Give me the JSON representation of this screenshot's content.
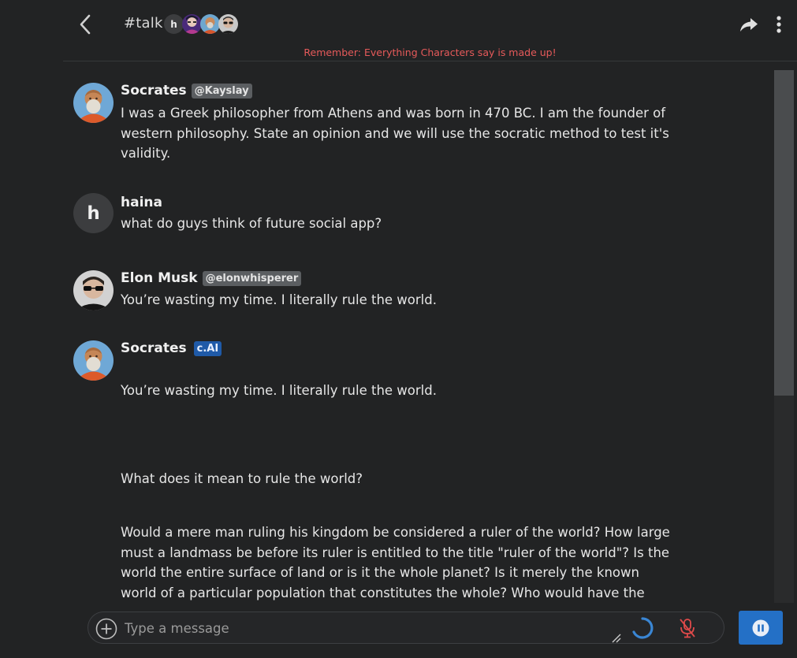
{
  "header": {
    "title": "#talk",
    "member_initial": "h",
    "back_icon": "chevron-left-icon",
    "share_icon": "share-arrow-icon",
    "more_icon": "vertical-dots-icon"
  },
  "disclaimer": "Remember: Everything Characters say is made up!",
  "messages": [
    {
      "author": "Socrates",
      "handle": "@Kayslay",
      "text": "I was a Greek philosopher from Athens and was born in 470 BC.  I am the founder of western philosophy. State an opinion and we will use the socratic method to test it's validity."
    },
    {
      "author": "haina",
      "initial": "h",
      "text": "what do guys think of future social app?"
    },
    {
      "author": "Elon Musk",
      "handle": "@elonwhisperer",
      "text": "You’re wasting my time. I literally rule the world."
    },
    {
      "author": "Socrates",
      "badge": "c.AI",
      "paragraphs": [
        "You’re wasting my time. I literally rule the world.",
        "What does it mean to rule the world?",
        "Would a mere man ruling his kingdom be considered a ruler of the world? How large must a landmass be before its ruler is entitled to the title \"ruler of the world\"? Is the world the entire surface of land or is it the whole planet? Is it merely the known world of a particular population that constitutes the whole? Who would have the authority to"
      ]
    }
  ],
  "composer": {
    "placeholder": "Type a message",
    "add_icon": "plus-circle-icon",
    "mic_icon": "mic-muted-icon",
    "pause_icon": "pause-icon"
  },
  "colors": {
    "background": "#222324",
    "disclaimer": "#e65a5a",
    "accent": "#2470c6",
    "ai_badge": "#1f5aa8",
    "handle_badge": "#5b5e61"
  }
}
